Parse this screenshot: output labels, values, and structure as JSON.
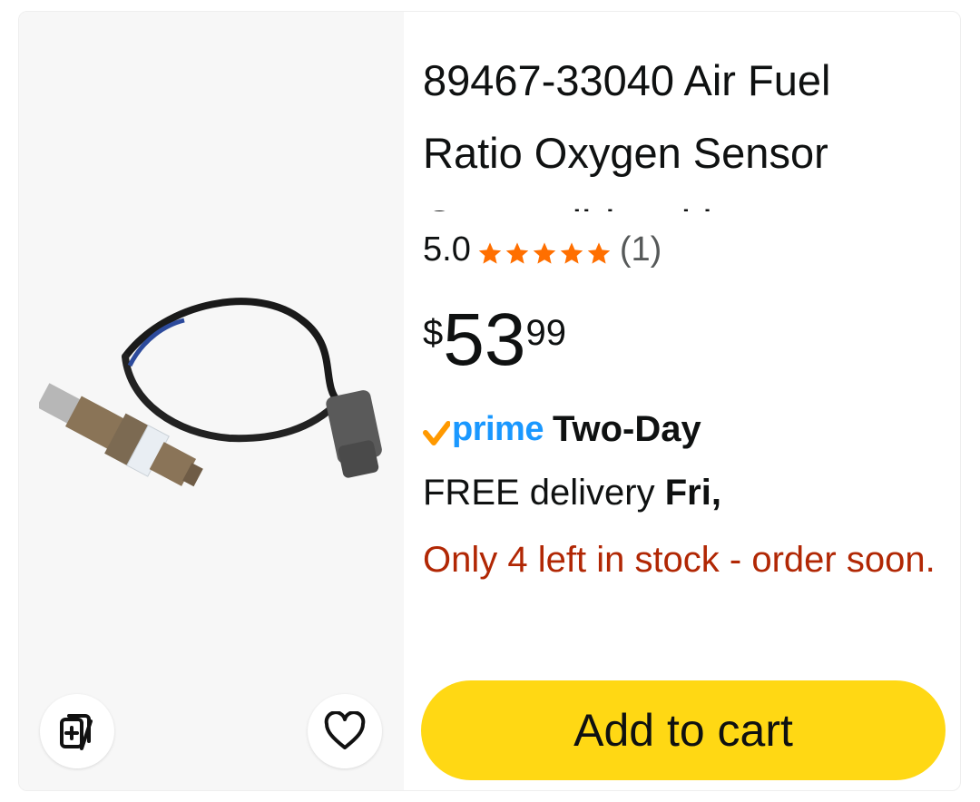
{
  "product": {
    "title": "89467-33040 Air Fuel Ratio Oxygen Sensor Compatible with",
    "rating": "5.0",
    "rating_count": "(1)",
    "stars": 5,
    "price": {
      "symbol": "$",
      "whole": "53",
      "fraction": "99"
    },
    "prime_label": "prime",
    "shipping_speed": "Two-Day",
    "delivery_prefix": "FREE delivery",
    "delivery_day": "Fri,",
    "stock_message": "Only 4 left in stock - order soon."
  },
  "actions": {
    "add_to_cart": "Add to cart",
    "similar_icon": "add-to-compare-icon",
    "wishlist_icon": "heart-icon"
  },
  "colors": {
    "star": "#ff6f00",
    "prime_blue": "#1a98ff",
    "prime_check": "#ff9900",
    "stock_red": "#b12704",
    "cart_yellow": "#ffd814"
  }
}
